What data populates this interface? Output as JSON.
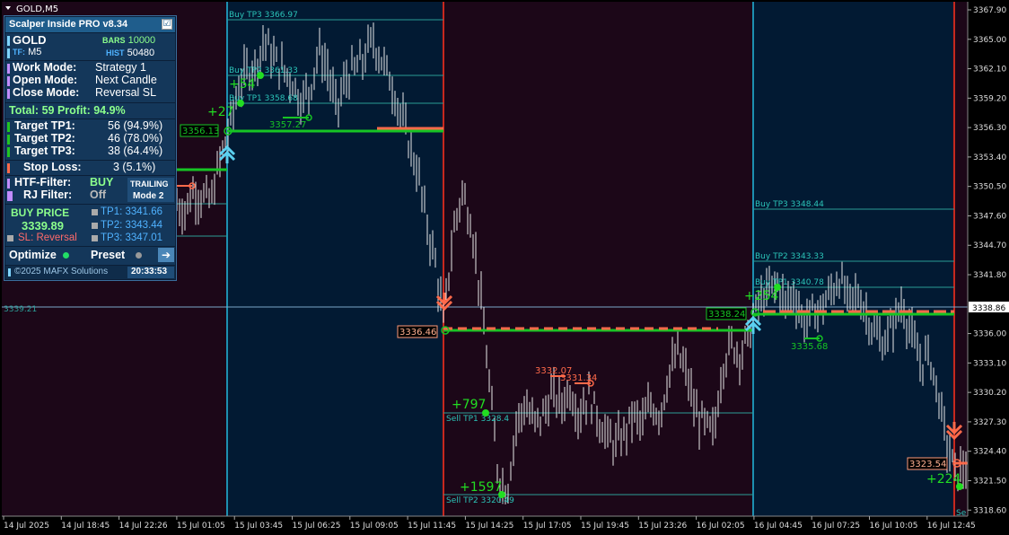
{
  "window": {
    "title": "GOLD,M5"
  },
  "chart_data": {
    "type": "candlestick",
    "symbol": "GOLD",
    "timeframe": "M5",
    "ylim": [
      3317.1,
      3368.9
    ],
    "price_ticks": [
      "3367.90",
      "3365.00",
      "3362.10",
      "3359.20",
      "3356.30",
      "3353.40",
      "3350.50",
      "3347.60",
      "3344.70",
      "3341.80",
      "3338.86",
      "3336.00",
      "3333.10",
      "3330.20",
      "3327.30",
      "3324.40",
      "3321.50",
      "3318.60"
    ],
    "time_labels": [
      "14 Jul 2025",
      "14 Jul 18:45",
      "14 Jul 22:26",
      "15 Jul 01:05",
      "15 Jul 03:45",
      "15 Jul 06:25",
      "15 Jul 09:05",
      "15 Jul 11:45",
      "15 Jul 14:25",
      "15 Jul 17:05",
      "15 Jul 19:45",
      "15 Jul 23:26",
      "16 Jul 02:05",
      "16 Jul 04:45",
      "16 Jul 07:25",
      "16 Jul 10:05",
      "16 Jul 12:45"
    ],
    "current_price": "3338.86",
    "current_price_marker": "3339.21",
    "sessions": [
      {
        "trend": "buy",
        "entry": "3356.13",
        "tp1_label": "Buy TP1 3358.68",
        "tp2_label": "Buy TP2 3361.33",
        "tp3_label": "Buy TP3 3366.97",
        "profit_labels": [
          "+27",
          "+54"
        ],
        "trailing_label": "3357.27"
      },
      {
        "trend": "sell",
        "entry": "3336.46",
        "tp1_label": "Sell TP1 3328.4",
        "tp2_label": "Sell TP2 3320.49",
        "profit_labels": [
          "+797",
          "+1597"
        ],
        "trailing_labels": [
          "3332.07",
          "3331.34"
        ]
      },
      {
        "trend": "buy",
        "entry": "3338.24",
        "tp1_label": "Buy TP1 3340.78",
        "tp2_label": "Buy TP2 3343.33",
        "tp3_label": "Buy TP3 3348.44",
        "profit_labels": [
          "+254"
        ],
        "trailing_label": "3335.68"
      },
      {
        "trend": "sell",
        "entry": "3323.54",
        "profit_labels": [
          "+224"
        ],
        "tp_label": "Se"
      }
    ]
  },
  "panel": {
    "title": "Scalper Inside PRO v8.34",
    "checkbox": "☑",
    "symbol": "GOLD",
    "bars_label": "BARS",
    "bars_value": "10000",
    "tf_label": "TF:",
    "tf_value": "M5",
    "hist_label": "HIST",
    "hist_value": "50480",
    "work_mode_label": "Work  Mode:",
    "work_mode_value": "Strategy 1",
    "open_mode_label": "Open  Mode:",
    "open_mode_value": "Next Candle",
    "close_mode_label": "Close Mode:",
    "close_mode_value": "Reversal SL",
    "total_text": "Total: 59  Profit: 94.9%",
    "tp1_label": "Target TP1:",
    "tp1_value": "56 (94.9%)",
    "tp2_label": "Target TP2:",
    "tp2_value": "46 (78.0%)",
    "tp3_label": "Target TP3:",
    "tp3_value": "38 (64.4%)",
    "sl_label": "Stop Loss:",
    "sl_value": "3 (5.1%)",
    "htf_label": "HTF-Filter:",
    "htf_value": "BUY",
    "rj_label": "RJ Filter:",
    "rj_value": "Off",
    "trailing_label": "TRAILING",
    "trailing_mode": "Mode 2",
    "buy_price_label": "BUY PRICE",
    "buy_price_value": "3339.89",
    "sl_reversal": "SL: Reversal",
    "tp1_price": "TP1: 3341.66",
    "tp2_price": "TP2: 3343.44",
    "tp3_price": "TP3: 3347.01",
    "optimize_label": "Optimize",
    "preset_label": "Preset",
    "arrow_icon": "➔",
    "copyright": "©2025 MAFX Solutions",
    "clock": "20:33:53"
  },
  "colors": {
    "buy": "#16c424",
    "sell": "#ff6a4a",
    "buy_zone": "#021a33",
    "sell_zone": "#1c0718"
  }
}
